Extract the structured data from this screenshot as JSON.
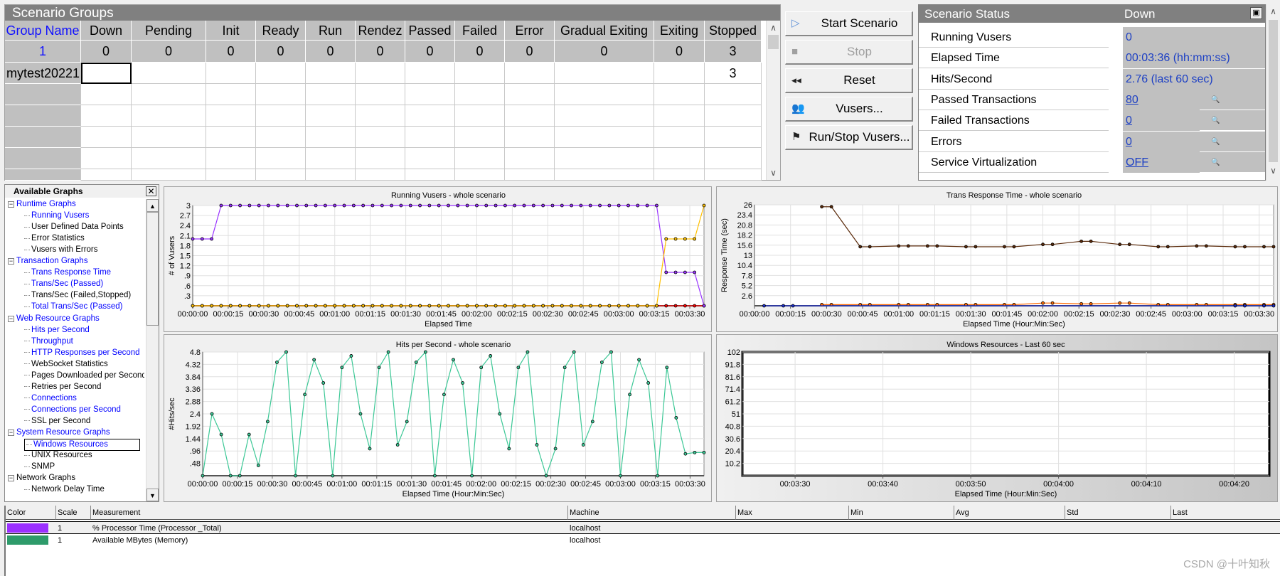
{
  "scenario_groups": {
    "title": "Scenario Groups",
    "columns": [
      "Group Name",
      "Down",
      "Pending",
      "Init",
      "Ready",
      "Run",
      "Rendez",
      "Passed",
      "Failed",
      "Error",
      "Gradual Exiting",
      "Exiting",
      "Stopped"
    ],
    "totals": [
      "1",
      "0",
      "0",
      "0",
      "0",
      "0",
      "0",
      "0",
      "0",
      "0",
      "0",
      "0",
      "3"
    ],
    "rows": [
      [
        "mytest20221",
        "",
        "",
        "",
        "",
        "",
        "",
        "",
        "",
        "",
        "",
        "",
        "3"
      ]
    ]
  },
  "buttons": [
    {
      "label": "Start Scenario",
      "icon": "play-icon",
      "enabled": true
    },
    {
      "label": "Stop",
      "icon": "stop-icon",
      "enabled": false
    },
    {
      "label": "Reset",
      "icon": "rewind-icon",
      "enabled": true
    },
    {
      "label": "Vusers...",
      "icon": "users-icon",
      "enabled": true
    },
    {
      "label": "Run/Stop Vusers...",
      "icon": "run-stop-icon",
      "enabled": true
    }
  ],
  "scenario_status": {
    "title": "Scenario Status",
    "state": "Down",
    "rows": [
      {
        "label": "Running Vusers",
        "value": "0",
        "link": false,
        "details": false
      },
      {
        "label": "Elapsed Time",
        "value": "00:03:36 (hh:mm:ss)",
        "link": false,
        "details": false
      },
      {
        "label": "Hits/Second",
        "value": "2.76 (last 60 sec)",
        "link": false,
        "details": false
      },
      {
        "label": "Passed Transactions",
        "value": "80",
        "link": true,
        "details": true
      },
      {
        "label": "Failed Transactions",
        "value": "0",
        "link": true,
        "details": true
      },
      {
        "label": "Errors",
        "value": "0",
        "link": true,
        "details": true
      },
      {
        "label": "Service Virtualization",
        "value": "OFF",
        "link": true,
        "details": true
      }
    ]
  },
  "available_graphs": {
    "title": "Available Graphs",
    "items": [
      {
        "label": "Runtime Graphs",
        "level": 0,
        "active": true
      },
      {
        "label": "Running Vusers",
        "level": 1,
        "active": true
      },
      {
        "label": "User Defined Data Points",
        "level": 1,
        "active": false
      },
      {
        "label": "Error Statistics",
        "level": 1,
        "active": false
      },
      {
        "label": "Vusers with Errors",
        "level": 1,
        "active": false
      },
      {
        "label": "Transaction Graphs",
        "level": 0,
        "active": true
      },
      {
        "label": "Trans Response Time",
        "level": 1,
        "active": true
      },
      {
        "label": "Trans/Sec (Passed)",
        "level": 1,
        "active": true
      },
      {
        "label": "Trans/Sec (Failed,Stopped)",
        "level": 1,
        "active": false
      },
      {
        "label": "Total Trans/Sec (Passed)",
        "level": 1,
        "active": true
      },
      {
        "label": "Web Resource Graphs",
        "level": 0,
        "active": true
      },
      {
        "label": "Hits per Second",
        "level": 1,
        "active": true
      },
      {
        "label": "Throughput",
        "level": 1,
        "active": true
      },
      {
        "label": "HTTP Responses per Second",
        "level": 1,
        "active": true
      },
      {
        "label": "WebSocket Statistics",
        "level": 1,
        "active": false
      },
      {
        "label": "Pages Downloaded per Second",
        "level": 1,
        "active": false
      },
      {
        "label": "Retries per Second",
        "level": 1,
        "active": false
      },
      {
        "label": "Connections",
        "level": 1,
        "active": true
      },
      {
        "label": "Connections per Second",
        "level": 1,
        "active": true
      },
      {
        "label": "SSL per Second",
        "level": 1,
        "active": false
      },
      {
        "label": "System Resource Graphs",
        "level": 0,
        "active": true
      },
      {
        "label": "Windows Resources",
        "level": 1,
        "active": true,
        "selected": true
      },
      {
        "label": "UNIX Resources",
        "level": 1,
        "active": false
      },
      {
        "label": "SNMP",
        "level": 1,
        "active": false
      },
      {
        "label": "Network Graphs",
        "level": 0,
        "active": false
      },
      {
        "label": "Network Delay Time",
        "level": 1,
        "active": false
      }
    ]
  },
  "chart_data": [
    {
      "type": "line",
      "title": "Running Vusers - whole scenario",
      "xlabel": "Elapsed Time",
      "ylabel": "# of Vusers",
      "xlim": [
        "00:00:00",
        "00:03:36"
      ],
      "ylim": [
        0,
        3
      ],
      "grid": true,
      "xticks": [
        "00:00:00",
        "00:00:15",
        "00:00:30",
        "00:00:45",
        "00:01:00",
        "00:01:15",
        "00:01:30",
        "00:01:45",
        "00:02:00",
        "00:02:15",
        "00:02:30",
        "00:02:45",
        "00:03:00",
        "00:03:15",
        "00:03:30"
      ],
      "yticks": [
        ".3",
        ".6",
        ".9",
        "1.2",
        "1.5",
        "1.8",
        "2.1",
        "2.4",
        "2.7",
        "3"
      ],
      "x": [
        "00:00:00",
        "00:00:04",
        "00:00:08",
        "00:00:12",
        "00:00:16",
        "00:00:20",
        "00:00:24",
        "00:00:28",
        "00:00:32",
        "00:00:36",
        "00:00:40",
        "00:00:44",
        "00:00:48",
        "00:00:52",
        "00:00:56",
        "00:01:00",
        "00:01:04",
        "00:01:08",
        "00:01:12",
        "00:01:16",
        "00:01:20",
        "00:01:24",
        "00:01:28",
        "00:01:32",
        "00:01:36",
        "00:01:40",
        "00:01:44",
        "00:01:48",
        "00:01:52",
        "00:01:56",
        "00:02:00",
        "00:02:04",
        "00:02:08",
        "00:02:12",
        "00:02:16",
        "00:02:20",
        "00:02:24",
        "00:02:28",
        "00:02:32",
        "00:02:36",
        "00:02:40",
        "00:02:44",
        "00:02:48",
        "00:02:52",
        "00:02:56",
        "00:03:00",
        "00:03:04",
        "00:03:08",
        "00:03:12",
        "00:03:16",
        "00:03:20",
        "00:03:24",
        "00:03:28",
        "00:03:32",
        "00:03:36"
      ],
      "series": [
        {
          "color": "#ff0000",
          "values": [
            0,
            0,
            0,
            0,
            0,
            0,
            0,
            0,
            0,
            0,
            0,
            0,
            0,
            0,
            0,
            0,
            0,
            0,
            0,
            0,
            0,
            0,
            0,
            0,
            0,
            0,
            0,
            0,
            0,
            0,
            0,
            0,
            0,
            0,
            0,
            0,
            0,
            0,
            0,
            0,
            0,
            0,
            0,
            0,
            0,
            0,
            0,
            0,
            0,
            0,
            0,
            0,
            0,
            0,
            0
          ]
        },
        {
          "color": "#9933ff",
          "values": [
            2,
            2,
            2,
            3,
            3,
            3,
            3,
            3,
            3,
            3,
            3,
            3,
            3,
            3,
            3,
            3,
            3,
            3,
            3,
            3,
            3,
            3,
            3,
            3,
            3,
            3,
            3,
            3,
            3,
            3,
            3,
            3,
            3,
            3,
            3,
            3,
            3,
            3,
            3,
            3,
            3,
            3,
            3,
            3,
            3,
            3,
            3,
            3,
            3,
            3,
            1,
            1,
            1,
            1,
            0
          ]
        },
        {
          "color": "#ffc000",
          "values": [
            0,
            0,
            0,
            0,
            0,
            0,
            0,
            0,
            0,
            0,
            0,
            0,
            0,
            0,
            0,
            0,
            0,
            0,
            0,
            0,
            0,
            0,
            0,
            0,
            0,
            0,
            0,
            0,
            0,
            0,
            0,
            0,
            0,
            0,
            0,
            0,
            0,
            0,
            0,
            0,
            0,
            0,
            0,
            0,
            0,
            0,
            0,
            0,
            0,
            0,
            2,
            2,
            2,
            2,
            3
          ]
        }
      ]
    },
    {
      "type": "line",
      "title": "Trans Response Time - whole scenario",
      "xlabel": "Elapsed Time (Hour:Min:Sec)",
      "ylabel": "Response Time (sec)",
      "xlim": [
        "00:00:00",
        "00:03:36"
      ],
      "ylim": [
        0,
        26
      ],
      "grid": true,
      "xticks": [
        "00:00:00",
        "00:00:15",
        "00:00:30",
        "00:00:45",
        "00:01:00",
        "00:01:15",
        "00:01:30",
        "00:01:45",
        "00:02:00",
        "00:02:15",
        "00:02:30",
        "00:02:45",
        "00:03:00",
        "00:03:15",
        "00:03:30"
      ],
      "yticks": [
        "2.6",
        "5.2",
        "7.8",
        "10.4",
        "13",
        "15.6",
        "18.2",
        "20.8",
        "23.4",
        "26"
      ],
      "series": [
        {
          "color": "#5a2a0a",
          "points": [
            [
              "00:00:28",
              25.5
            ],
            [
              "00:00:32",
              25.5
            ],
            [
              "00:00:44",
              15.2
            ],
            [
              "00:00:48",
              15.2
            ],
            [
              "00:01:00",
              15.4
            ],
            [
              "00:01:04",
              15.4
            ],
            [
              "00:01:12",
              15.4
            ],
            [
              "00:01:16",
              15.4
            ],
            [
              "00:01:28",
              15.2
            ],
            [
              "00:01:32",
              15.2
            ],
            [
              "00:01:44",
              15.2
            ],
            [
              "00:01:48",
              15.2
            ],
            [
              "00:02:00",
              15.8
            ],
            [
              "00:02:04",
              15.8
            ],
            [
              "00:02:16",
              16.6
            ],
            [
              "00:02:20",
              16.6
            ],
            [
              "00:02:32",
              15.8
            ],
            [
              "00:02:36",
              15.8
            ],
            [
              "00:02:48",
              15.2
            ],
            [
              "00:02:52",
              15.2
            ],
            [
              "00:03:04",
              15.4
            ],
            [
              "00:03:08",
              15.4
            ],
            [
              "00:03:20",
              15.2
            ],
            [
              "00:03:24",
              15.2
            ],
            [
              "00:03:32",
              15.2
            ],
            [
              "00:03:36",
              15.2
            ]
          ]
        },
        {
          "color": "#ff6a00",
          "points": [
            [
              "00:00:28",
              0.3
            ],
            [
              "00:00:32",
              0.3
            ],
            [
              "00:00:44",
              0.3
            ],
            [
              "00:00:48",
              0.3
            ],
            [
              "00:01:00",
              0.3
            ],
            [
              "00:01:04",
              0.3
            ],
            [
              "00:01:12",
              0.3
            ],
            [
              "00:01:16",
              0.3
            ],
            [
              "00:01:28",
              0.3
            ],
            [
              "00:01:32",
              0.3
            ],
            [
              "00:01:44",
              0.3
            ],
            [
              "00:01:48",
              0.3
            ],
            [
              "00:02:00",
              0.7
            ],
            [
              "00:02:04",
              0.7
            ],
            [
              "00:02:16",
              0.5
            ],
            [
              "00:02:20",
              0.5
            ],
            [
              "00:02:32",
              0.7
            ],
            [
              "00:02:36",
              0.7
            ],
            [
              "00:02:48",
              0.3
            ],
            [
              "00:02:52",
              0.3
            ],
            [
              "00:03:04",
              0.3
            ],
            [
              "00:03:08",
              0.3
            ],
            [
              "00:03:20",
              0.3
            ],
            [
              "00:03:24",
              0.3
            ],
            [
              "00:03:32",
              0.3
            ],
            [
              "00:03:36",
              0.3
            ]
          ]
        },
        {
          "color": "#1a2ccc",
          "points": [
            [
              "00:00:04",
              0
            ],
            [
              "00:00:12",
              0
            ],
            [
              "00:00:16",
              0
            ],
            [
              "00:03:20",
              0
            ],
            [
              "00:03:24",
              0
            ],
            [
              "00:03:32",
              0
            ],
            [
              "00:03:36",
              0
            ]
          ]
        }
      ]
    },
    {
      "type": "line",
      "title": "Hits per Second - whole scenario",
      "xlabel": "Elapsed Time (Hour:Min:Sec)",
      "ylabel": "#Hits/sec",
      "xlim": [
        "00:00:00",
        "00:03:36"
      ],
      "ylim": [
        0,
        4.8
      ],
      "grid": true,
      "xticks": [
        "00:00:00",
        "00:00:15",
        "00:00:30",
        "00:00:45",
        "00:01:00",
        "00:01:15",
        "00:01:30",
        "00:01:45",
        "00:02:00",
        "00:02:15",
        "00:02:30",
        "00:02:45",
        "00:03:00",
        "00:03:15",
        "00:03:30"
      ],
      "yticks": [
        ".48",
        ".96",
        "1.44",
        "1.92",
        "2.4",
        "2.88",
        "3.36",
        "3.84",
        "4.32",
        "4.8"
      ],
      "x": [
        "00:00:00",
        "00:00:04",
        "00:00:08",
        "00:00:12",
        "00:00:16",
        "00:00:20",
        "00:00:24",
        "00:00:28",
        "00:00:32",
        "00:00:36",
        "00:00:40",
        "00:00:44",
        "00:00:48",
        "00:00:52",
        "00:00:56",
        "00:01:00",
        "00:01:04",
        "00:01:08",
        "00:01:12",
        "00:01:16",
        "00:01:20",
        "00:01:24",
        "00:01:28",
        "00:01:32",
        "00:01:36",
        "00:01:40",
        "00:01:44",
        "00:01:48",
        "00:01:52",
        "00:01:56",
        "00:02:00",
        "00:02:04",
        "00:02:08",
        "00:02:12",
        "00:02:16",
        "00:02:20",
        "00:02:24",
        "00:02:28",
        "00:02:32",
        "00:02:36",
        "00:02:40",
        "00:02:44",
        "00:02:48",
        "00:02:52",
        "00:02:56",
        "00:03:00",
        "00:03:04",
        "00:03:08",
        "00:03:12",
        "00:03:16",
        "00:03:20",
        "00:03:24",
        "00:03:28",
        "00:03:32",
        "00:03:36"
      ],
      "series": [
        {
          "color": "#3cc896",
          "values": [
            0,
            2.4,
            1.6,
            0,
            0,
            1.6,
            0.4,
            2.1,
            4.4,
            4.8,
            0,
            3.15,
            4.5,
            3.6,
            0,
            4.2,
            4.65,
            2.4,
            1.05,
            4.2,
            4.8,
            1.2,
            2.1,
            4.4,
            4.8,
            0,
            3.15,
            4.5,
            3.6,
            0,
            4.2,
            4.65,
            2.4,
            1.05,
            4.2,
            4.8,
            1.2,
            0,
            1.05,
            4.2,
            4.8,
            1.2,
            2.1,
            4.4,
            4.8,
            0,
            3.15,
            4.5,
            3.6,
            0,
            4.2,
            2.25,
            0.85,
            0.9,
            0.9
          ]
        }
      ]
    },
    {
      "type": "line",
      "title": "Windows Resources - Last 60 sec",
      "xlabel": "Elapsed Time (Hour:Min:Sec)",
      "ylabel": "",
      "xlim": [
        "00:03:24",
        "00:04:24"
      ],
      "ylim": [
        0,
        102
      ],
      "grid": true,
      "xticks": [
        "00:03:30",
        "00:03:40",
        "00:03:50",
        "00:04:00",
        "00:04:10",
        "00:04:20"
      ],
      "yticks": [
        "10.2",
        "20.4",
        "30.6",
        "40.8",
        "51",
        "61.2",
        "71.4",
        "81.6",
        "91.8",
        "102"
      ],
      "series": []
    }
  ],
  "measurements": {
    "columns": [
      "Color",
      "Scale",
      "Measurement",
      "Machine",
      "Max",
      "Min",
      "Avg",
      "Std",
      "Last"
    ],
    "rows": [
      {
        "color": "#9b30ff",
        "scale": "1",
        "measurement": "% Processor Time (Processor _Total)",
        "machine": "localhost"
      },
      {
        "color": "#2e9b6b",
        "scale": "1",
        "measurement": "Available MBytes (Memory)",
        "machine": "localhost"
      }
    ]
  },
  "watermark": "CSDN @十叶知秋"
}
